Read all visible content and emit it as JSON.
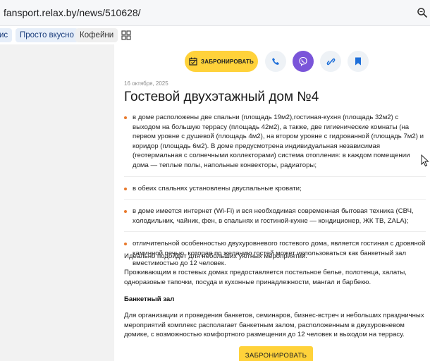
{
  "browser": {
    "url": "fansport.relax.by/news/510628/",
    "zoom_icon": "zoom-magnifier-icon"
  },
  "bookmarks": {
    "items": [
      {
        "label": "ис"
      },
      {
        "label": "Просто вкусно"
      },
      {
        "label": "Кофейни"
      }
    ],
    "apps_icon": "apps-grid-icon"
  },
  "actions": {
    "book_label": "ЗАБРОНИРОВАТЬ",
    "icons": [
      "calendar-check-icon",
      "phone-icon",
      "viber-icon",
      "link-icon",
      "bookmark-icon"
    ],
    "accent": "#ffd23a",
    "viber_color": "#7a55d9"
  },
  "article": {
    "date": "16 октября, 2025",
    "title": "Гостевой двухэтажный дом №4",
    "features": [
      "в доме расположены две спальни (площадь 19м2),гостиная-кухня (площадь 32м2) с выходом на большую террасу (площадь 42м2), а также, две гигиенические комнаты (на первом уровне с душевой (площадь 4м2), на втором уровне с гидрованной (площадь 7м2) и коридор (площадь 6м2). В доме предусмотрена индивидуальная независимая (геотермальная с солнечными коллекторами) система отопления: в каждом помещении дома — теплые полы, напольные конвекторы, радиаторы;",
      "в обеих спальнях установлены двуспальные кровати;",
      "в доме имеется интернет (Wi-Fi) и вся необходимая современная бытовая техника (СВЧ, холодильник, чайник, фен, в спальнях и гостиной-кухне — кондиционер, ЖК ТВ, ZALA);",
      "отличительной особенностью двухуровневого гостевого дома, является гостиная с дровяной каминной печью, которая по желанию гостей может использоваться как банкетный зал вместимостью до 12 человек."
    ],
    "para1": "Идеально подойдет для небольших уютных мероприятий.",
    "para2": "Проживающим в гостевых домах предоставляется постельное белье, полотенца, халаты, одноразовые тапочки, посуда и кухонные принадлежности, мангал и барбекю.",
    "banquet_heading": "Банкетный зал",
    "para3": "Для организации и проведения банкетов, семинаров, бизнес-встреч и небольших праздничных мероприятий комплекс располагает банкетным залом, расположенным в двухуровневом домике, с возможностью комфортного размещения до 12 человек и выходом на террасу.",
    "book_bottom_label": "ЗАБРОНИРОВАТЬ"
  }
}
